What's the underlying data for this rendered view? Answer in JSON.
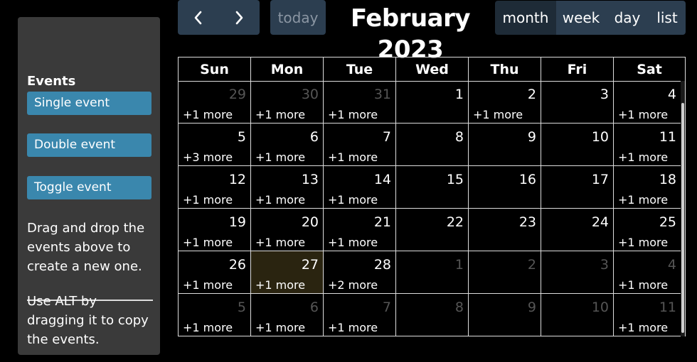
{
  "sidebar": {
    "heading": "Events",
    "events": [
      "Single event",
      "Double event",
      "Toggle event"
    ],
    "help1": "Drag and drop the events above to create a new one.",
    "help2": "Use ALT by dragging it to copy the events."
  },
  "toolbar": {
    "prev": "‹",
    "next": "›",
    "today": "today",
    "title": "February 2023",
    "views": [
      "month",
      "week",
      "day",
      "list"
    ]
  },
  "calendar": {
    "days_of_week": [
      "Sun",
      "Mon",
      "Tue",
      "Wed",
      "Thu",
      "Fri",
      "Sat"
    ],
    "weeks": [
      [
        {
          "n": "29",
          "o": true,
          "m": "+1 more"
        },
        {
          "n": "30",
          "o": true,
          "m": "+1 more"
        },
        {
          "n": "31",
          "o": true,
          "m": "+1 more"
        },
        {
          "n": "1",
          "o": false,
          "m": ""
        },
        {
          "n": "2",
          "o": false,
          "m": "+1 more"
        },
        {
          "n": "3",
          "o": false,
          "m": ""
        },
        {
          "n": "4",
          "o": false,
          "m": "+1 more"
        }
      ],
      [
        {
          "n": "5",
          "o": false,
          "m": "+3 more"
        },
        {
          "n": "6",
          "o": false,
          "m": "+1 more"
        },
        {
          "n": "7",
          "o": false,
          "m": "+1 more"
        },
        {
          "n": "8",
          "o": false,
          "m": ""
        },
        {
          "n": "9",
          "o": false,
          "m": ""
        },
        {
          "n": "10",
          "o": false,
          "m": ""
        },
        {
          "n": "11",
          "o": false,
          "m": "+1 more"
        }
      ],
      [
        {
          "n": "12",
          "o": false,
          "m": "+1 more"
        },
        {
          "n": "13",
          "o": false,
          "m": "+1 more"
        },
        {
          "n": "14",
          "o": false,
          "m": "+1 more"
        },
        {
          "n": "15",
          "o": false,
          "m": ""
        },
        {
          "n": "16",
          "o": false,
          "m": ""
        },
        {
          "n": "17",
          "o": false,
          "m": ""
        },
        {
          "n": "18",
          "o": false,
          "m": "+1 more"
        }
      ],
      [
        {
          "n": "19",
          "o": false,
          "m": "+1 more"
        },
        {
          "n": "20",
          "o": false,
          "m": "+1 more"
        },
        {
          "n": "21",
          "o": false,
          "m": "+1 more"
        },
        {
          "n": "22",
          "o": false,
          "m": ""
        },
        {
          "n": "23",
          "o": false,
          "m": ""
        },
        {
          "n": "24",
          "o": false,
          "m": ""
        },
        {
          "n": "25",
          "o": false,
          "m": "+1 more"
        }
      ],
      [
        {
          "n": "26",
          "o": false,
          "m": "+1 more"
        },
        {
          "n": "27",
          "o": false,
          "m": "+1 more",
          "today": true
        },
        {
          "n": "28",
          "o": false,
          "m": "+2 more"
        },
        {
          "n": "1",
          "o": true,
          "m": ""
        },
        {
          "n": "2",
          "o": true,
          "m": ""
        },
        {
          "n": "3",
          "o": true,
          "m": ""
        },
        {
          "n": "4",
          "o": true,
          "m": "+1 more"
        }
      ],
      [
        {
          "n": "5",
          "o": true,
          "m": "+1 more"
        },
        {
          "n": "6",
          "o": true,
          "m": "+1 more"
        },
        {
          "n": "7",
          "o": true,
          "m": "+1 more"
        },
        {
          "n": "8",
          "o": true,
          "m": ""
        },
        {
          "n": "9",
          "o": true,
          "m": ""
        },
        {
          "n": "10",
          "o": true,
          "m": ""
        },
        {
          "n": "11",
          "o": true,
          "m": "+1 more"
        }
      ]
    ]
  },
  "colors": {
    "event_bg": "#3a87ad",
    "button_bg": "#2c3e50",
    "active_view_bg": "#1e2b37",
    "today_bg": "#2a2410"
  }
}
